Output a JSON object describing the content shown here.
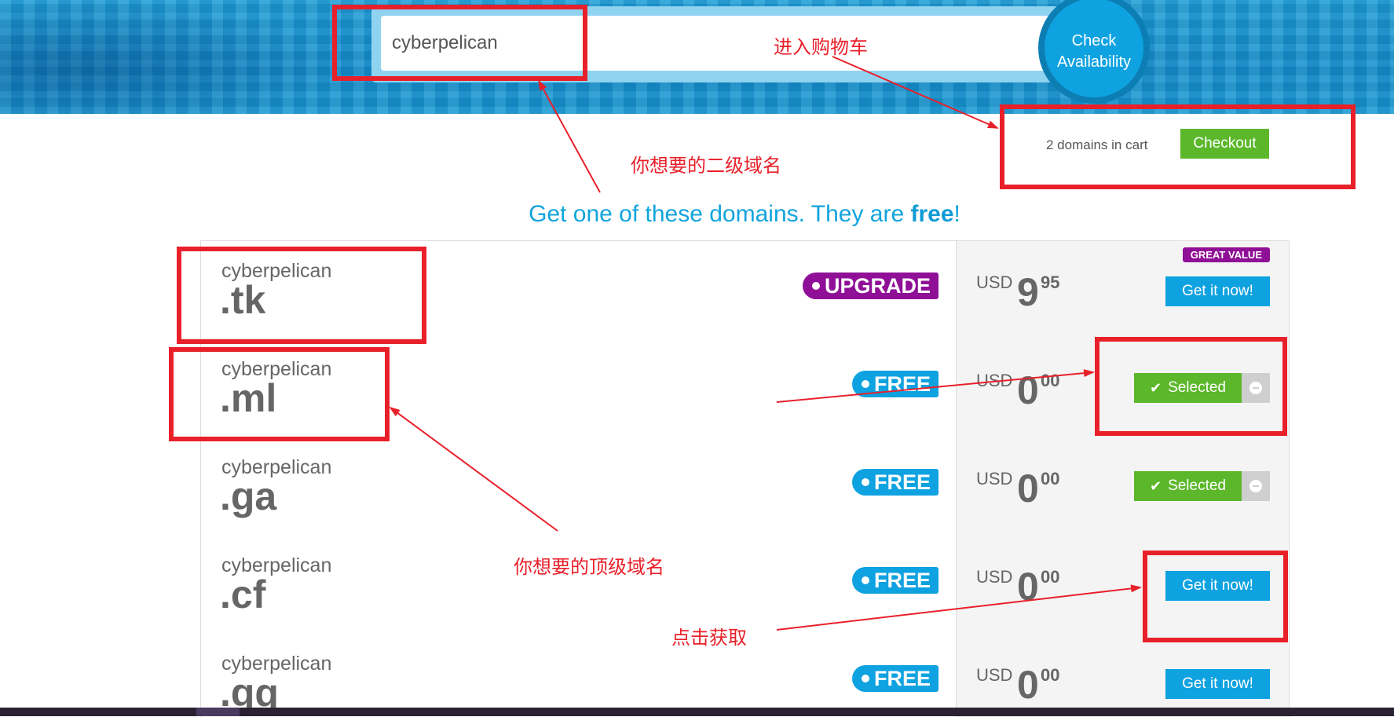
{
  "search": {
    "value": "cyberpelican",
    "button_line1": "Check",
    "button_line2": "Availability"
  },
  "cart": {
    "count_text": "2 domains in cart",
    "checkout_label": "Checkout"
  },
  "headline": {
    "prefix": "Get one of these domains. They are ",
    "emphasis": "free",
    "suffix": "!"
  },
  "domains": [
    {
      "sld": "cyberpelican",
      "tld": ".tk",
      "badge": "UPGRADE",
      "currency": "USD",
      "price_int": "9",
      "price_dec": "95",
      "tag": "GREAT VALUE",
      "action": "Get it now!"
    },
    {
      "sld": "cyberpelican",
      "tld": ".ml",
      "badge": "FREE",
      "currency": "USD",
      "price_int": "0",
      "price_dec": "00",
      "action": "Selected"
    },
    {
      "sld": "cyberpelican",
      "tld": ".ga",
      "badge": "FREE",
      "currency": "USD",
      "price_int": "0",
      "price_dec": "00",
      "action": "Selected"
    },
    {
      "sld": "cyberpelican",
      "tld": ".cf",
      "badge": "FREE",
      "currency": "USD",
      "price_int": "0",
      "price_dec": "00",
      "action": "Get it now!"
    },
    {
      "sld": "cyberpelican",
      "tld": ".gq",
      "badge": "FREE",
      "currency": "USD",
      "price_int": "0",
      "price_dec": "00",
      "action": "Get it now!"
    }
  ],
  "annotations": {
    "cart_note": "进入购物车",
    "sld_note": "你想要的二级域名",
    "tld_note": "你想要的顶级域名",
    "click_note": "点击获取"
  },
  "colors": {
    "accent_blue": "#0fa2e0",
    "green": "#5cb72b",
    "purple": "#8f0f96",
    "annotation_red": "#e8202a"
  }
}
